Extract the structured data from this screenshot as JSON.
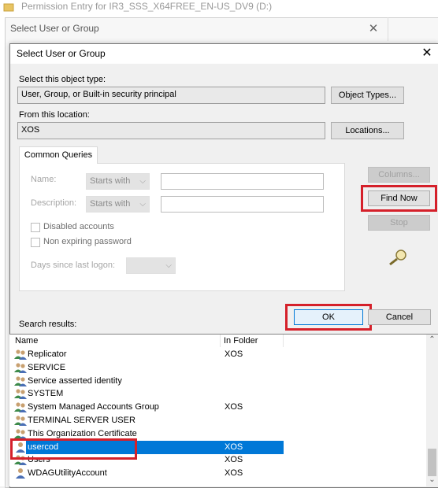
{
  "background_window": {
    "title": "Permission Entry for IR3_SSS_X64FREE_EN-US_DV9 (D:)"
  },
  "middle_dialog": {
    "title": "Select User or Group"
  },
  "dialog": {
    "title": "Select User or Group",
    "object_type_label": "Select this object type:",
    "object_type_value": "User, Group, or Built-in security principal",
    "object_types_button": "Object Types...",
    "location_label": "From this location:",
    "location_value": "XOS",
    "locations_button": "Locations...",
    "tab_label": "Common Queries",
    "name_label": "Name:",
    "name_mode": "Starts with",
    "description_label": "Description:",
    "description_mode": "Starts with",
    "disabled_accounts_label": "Disabled accounts",
    "non_expiring_label": "Non expiring password",
    "days_since_logon_label": "Days since last logon:",
    "columns_button": "Columns...",
    "find_now_button": "Find Now",
    "stop_button": "Stop",
    "ok_button": "OK",
    "cancel_button": "Cancel",
    "search_results_label": "Search results:"
  },
  "results": {
    "columns": [
      "Name",
      "In Folder"
    ],
    "rows": [
      {
        "name": "Replicator",
        "folder": "XOS",
        "icon": "group-icon"
      },
      {
        "name": "SERVICE",
        "folder": "",
        "icon": "group-icon"
      },
      {
        "name": "Service asserted identity",
        "folder": "",
        "icon": "group-icon"
      },
      {
        "name": "SYSTEM",
        "folder": "",
        "icon": "group-icon"
      },
      {
        "name": "System Managed Accounts Group",
        "folder": "XOS",
        "icon": "group-icon"
      },
      {
        "name": "TERMINAL SERVER USER",
        "folder": "",
        "icon": "group-icon"
      },
      {
        "name": "This Organization Certificate",
        "folder": "",
        "icon": "group-icon"
      },
      {
        "name": "usercod",
        "folder": "XOS",
        "icon": "user-icon",
        "selected": true
      },
      {
        "name": "Users",
        "folder": "XOS",
        "icon": "group-icon"
      },
      {
        "name": "WDAGUtilityAccount",
        "folder": "XOS",
        "icon": "user-icon"
      }
    ]
  },
  "colors": {
    "highlight": "#d5202a",
    "selection": "#0078d7"
  }
}
